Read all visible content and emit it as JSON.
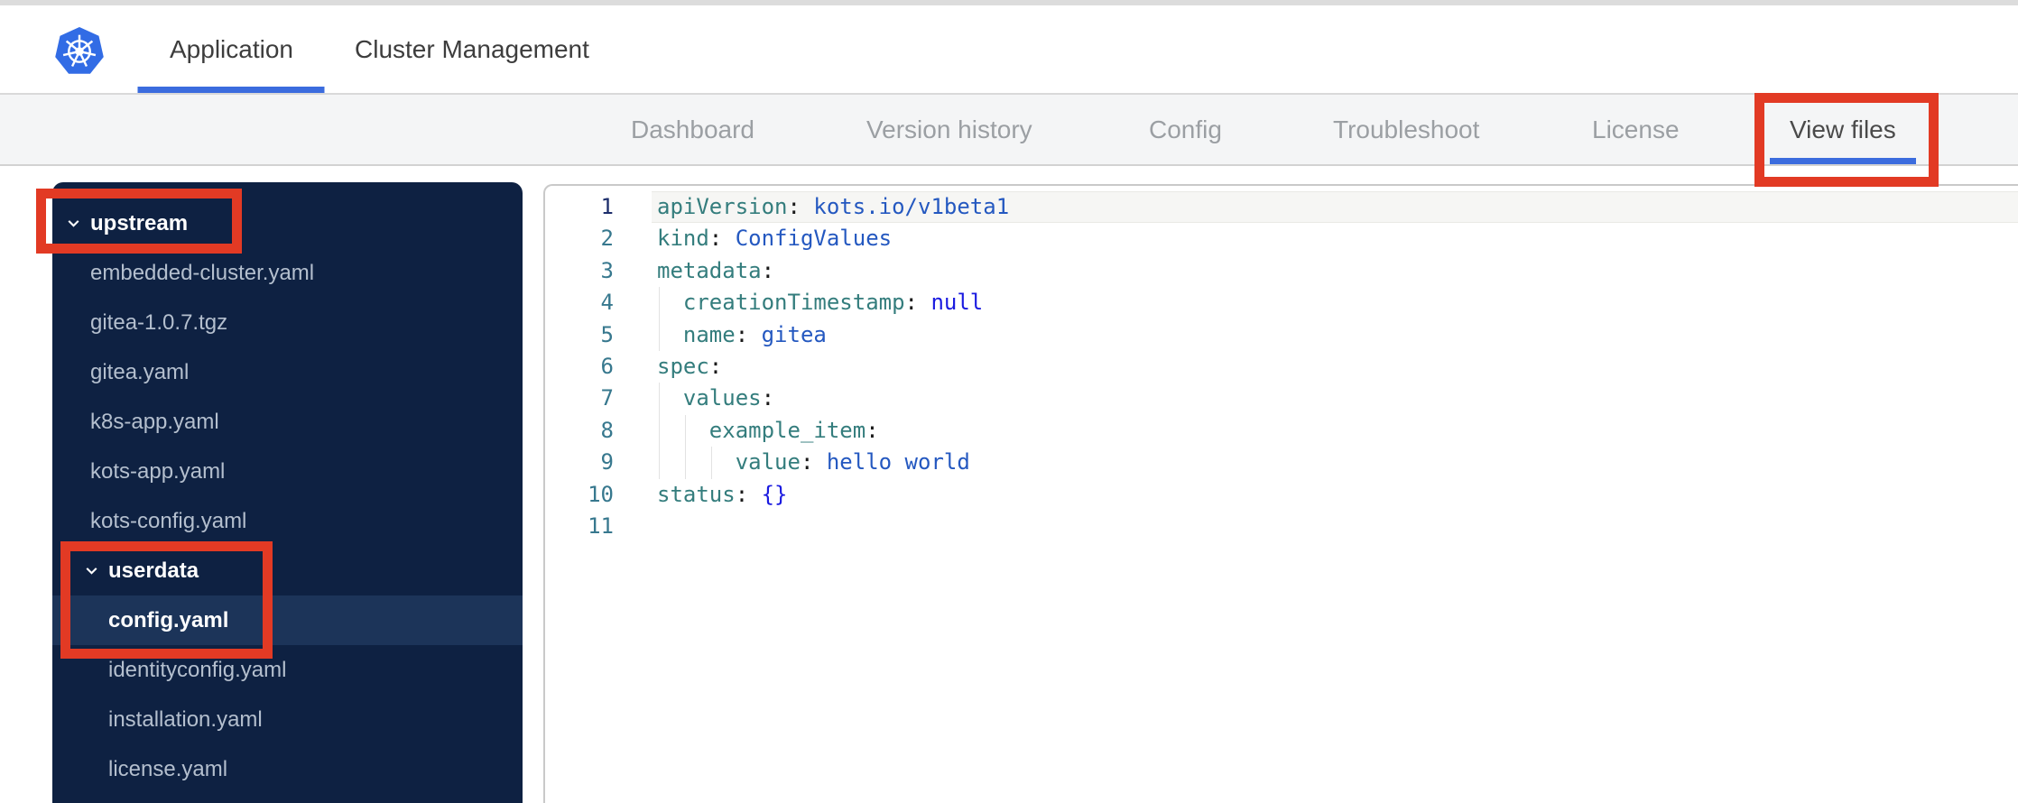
{
  "colors": {
    "accent_blue": "#3b6cde",
    "kubernetes_blue": "#326ce5",
    "annotation_red": "#e23a24",
    "sidebar_bg": "#0e2142",
    "sidebar_selected_bg": "#1c3459",
    "sidebar_file_text": "#b4bfce",
    "nav_inactive_text": "#9b9fa3",
    "nav_active_text": "#4a4a4a",
    "code_key": "#347d7d",
    "code_punct": "#1a1a1a",
    "code_string": "#2458c0",
    "code_keyword": "#1a1ae0",
    "line_number": "#37788e",
    "line_number_active": "#1c2d6b",
    "active_line_bg": "#f6f6f4"
  },
  "header": {
    "logo": "kubernetes-logo",
    "tabs": [
      {
        "label": "Application",
        "active": true
      },
      {
        "label": "Cluster Management",
        "active": false
      }
    ]
  },
  "nav": {
    "items": [
      {
        "label": "Dashboard",
        "active": false
      },
      {
        "label": "Version history",
        "active": false
      },
      {
        "label": "Config",
        "active": false
      },
      {
        "label": "Troubleshoot",
        "active": false
      },
      {
        "label": "License",
        "active": false
      },
      {
        "label": "View files",
        "active": true
      }
    ]
  },
  "file_tree": {
    "items": [
      {
        "label": "upstream",
        "type": "folder",
        "level": 0,
        "expanded": true,
        "selected": false
      },
      {
        "label": "embedded-cluster.yaml",
        "type": "file",
        "level": 1,
        "selected": false
      },
      {
        "label": "gitea-1.0.7.tgz",
        "type": "file",
        "level": 1,
        "selected": false
      },
      {
        "label": "gitea.yaml",
        "type": "file",
        "level": 1,
        "selected": false
      },
      {
        "label": "k8s-app.yaml",
        "type": "file",
        "level": 1,
        "selected": false
      },
      {
        "label": "kots-app.yaml",
        "type": "file",
        "level": 1,
        "selected": false
      },
      {
        "label": "kots-config.yaml",
        "type": "file",
        "level": 1,
        "selected": false
      },
      {
        "label": "userdata",
        "type": "folder",
        "level": 1,
        "expanded": true,
        "selected": false
      },
      {
        "label": "config.yaml",
        "type": "file",
        "level": 2,
        "selected": true
      },
      {
        "label": "identityconfig.yaml",
        "type": "file",
        "level": 2,
        "selected": false
      },
      {
        "label": "installation.yaml",
        "type": "file",
        "level": 2,
        "selected": false
      },
      {
        "label": "license.yaml",
        "type": "file",
        "level": 2,
        "selected": false
      }
    ]
  },
  "editor": {
    "language": "yaml",
    "lines": [
      {
        "num": 1,
        "active": true,
        "indent": 0,
        "guides": 0,
        "tokens": [
          {
            "t": "key",
            "s": "apiVersion"
          },
          {
            "t": "punct",
            "s": ":"
          },
          {
            "t": "plain",
            "s": " "
          },
          {
            "t": "string",
            "s": "kots.io/v1beta1"
          }
        ]
      },
      {
        "num": 2,
        "active": false,
        "indent": 0,
        "guides": 0,
        "tokens": [
          {
            "t": "key",
            "s": "kind"
          },
          {
            "t": "punct",
            "s": ":"
          },
          {
            "t": "plain",
            "s": " "
          },
          {
            "t": "string",
            "s": "ConfigValues"
          }
        ]
      },
      {
        "num": 3,
        "active": false,
        "indent": 0,
        "guides": 0,
        "tokens": [
          {
            "t": "key",
            "s": "metadata"
          },
          {
            "t": "punct",
            "s": ":"
          }
        ]
      },
      {
        "num": 4,
        "active": false,
        "indent": 2,
        "guides": 1,
        "tokens": [
          {
            "t": "key",
            "s": "creationTimestamp"
          },
          {
            "t": "punct",
            "s": ":"
          },
          {
            "t": "plain",
            "s": " "
          },
          {
            "t": "keyword",
            "s": "null"
          }
        ]
      },
      {
        "num": 5,
        "active": false,
        "indent": 2,
        "guides": 1,
        "tokens": [
          {
            "t": "key",
            "s": "name"
          },
          {
            "t": "punct",
            "s": ":"
          },
          {
            "t": "plain",
            "s": " "
          },
          {
            "t": "string",
            "s": "gitea"
          }
        ]
      },
      {
        "num": 6,
        "active": false,
        "indent": 0,
        "guides": 0,
        "tokens": [
          {
            "t": "key",
            "s": "spec"
          },
          {
            "t": "punct",
            "s": ":"
          }
        ]
      },
      {
        "num": 7,
        "active": false,
        "indent": 2,
        "guides": 1,
        "tokens": [
          {
            "t": "key",
            "s": "values"
          },
          {
            "t": "punct",
            "s": ":"
          }
        ]
      },
      {
        "num": 8,
        "active": false,
        "indent": 4,
        "guides": 2,
        "tokens": [
          {
            "t": "key",
            "s": "example_item"
          },
          {
            "t": "punct",
            "s": ":"
          }
        ]
      },
      {
        "num": 9,
        "active": false,
        "indent": 6,
        "guides": 3,
        "tokens": [
          {
            "t": "key",
            "s": "value"
          },
          {
            "t": "punct",
            "s": ":"
          },
          {
            "t": "plain",
            "s": " "
          },
          {
            "t": "string",
            "s": "hello world"
          }
        ]
      },
      {
        "num": 10,
        "active": false,
        "indent": 0,
        "guides": 0,
        "tokens": [
          {
            "t": "key",
            "s": "status"
          },
          {
            "t": "punct",
            "s": ":"
          },
          {
            "t": "plain",
            "s": " "
          },
          {
            "t": "keyword",
            "s": "{}"
          }
        ]
      },
      {
        "num": 11,
        "active": false,
        "indent": 0,
        "guides": 0,
        "tokens": []
      }
    ]
  },
  "annotations": {
    "boxes": [
      {
        "target": "upstream-folder"
      },
      {
        "target": "userdata-config-yaml"
      },
      {
        "target": "view-files-tab"
      }
    ]
  }
}
